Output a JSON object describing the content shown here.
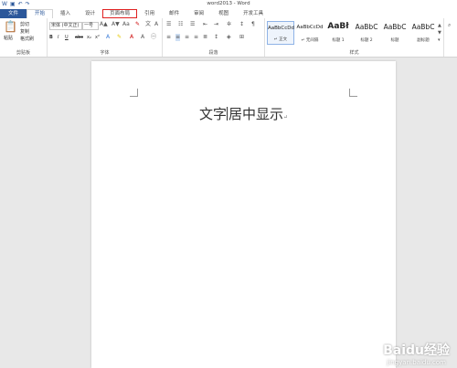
{
  "window": {
    "title": "word2013 - Word"
  },
  "qat": {
    "save_icon": "save-icon",
    "undo_icon": "undo-icon",
    "redo_icon": "redo-icon"
  },
  "tabs": [
    {
      "label": "文件"
    },
    {
      "label": "开始"
    },
    {
      "label": "插入"
    },
    {
      "label": "设计"
    },
    {
      "label": "页面布局"
    },
    {
      "label": "引用"
    },
    {
      "label": "邮件"
    },
    {
      "label": "审阅"
    },
    {
      "label": "视图"
    },
    {
      "label": "开发工具"
    }
  ],
  "clipboard": {
    "paste": "粘贴",
    "cut": "剪切",
    "copy": "复制",
    "format_painter": "格式刷",
    "label": "剪贴板"
  },
  "font": {
    "name": "宋体 (中文正)",
    "size": "一号",
    "buttons": [
      "B",
      "I",
      "U",
      "abc",
      "x₂",
      "x²"
    ],
    "label": "字体"
  },
  "paragraph": {
    "label": "段落"
  },
  "styles": {
    "items": [
      {
        "preview": "AaBbCcDd",
        "name": "↵ 正文"
      },
      {
        "preview": "AaBbCcDd",
        "name": "↵ 无间隔"
      },
      {
        "preview": "AaBł",
        "name": "标题 1"
      },
      {
        "preview": "AaBbC",
        "name": "标题 2"
      },
      {
        "preview": "AaBbC",
        "name": "标题"
      },
      {
        "preview": "AaBbC",
        "name": "副标题"
      }
    ],
    "label": "样式"
  },
  "document": {
    "text_before": "文字",
    "text_after": "居中显示",
    "para_mark": "↵"
  },
  "watermark": {
    "text": "Baidu经验",
    "url": "jingyan.baidu.com"
  },
  "colors": {
    "accent": "#2b579a",
    "highlight_box": "#e02020"
  }
}
